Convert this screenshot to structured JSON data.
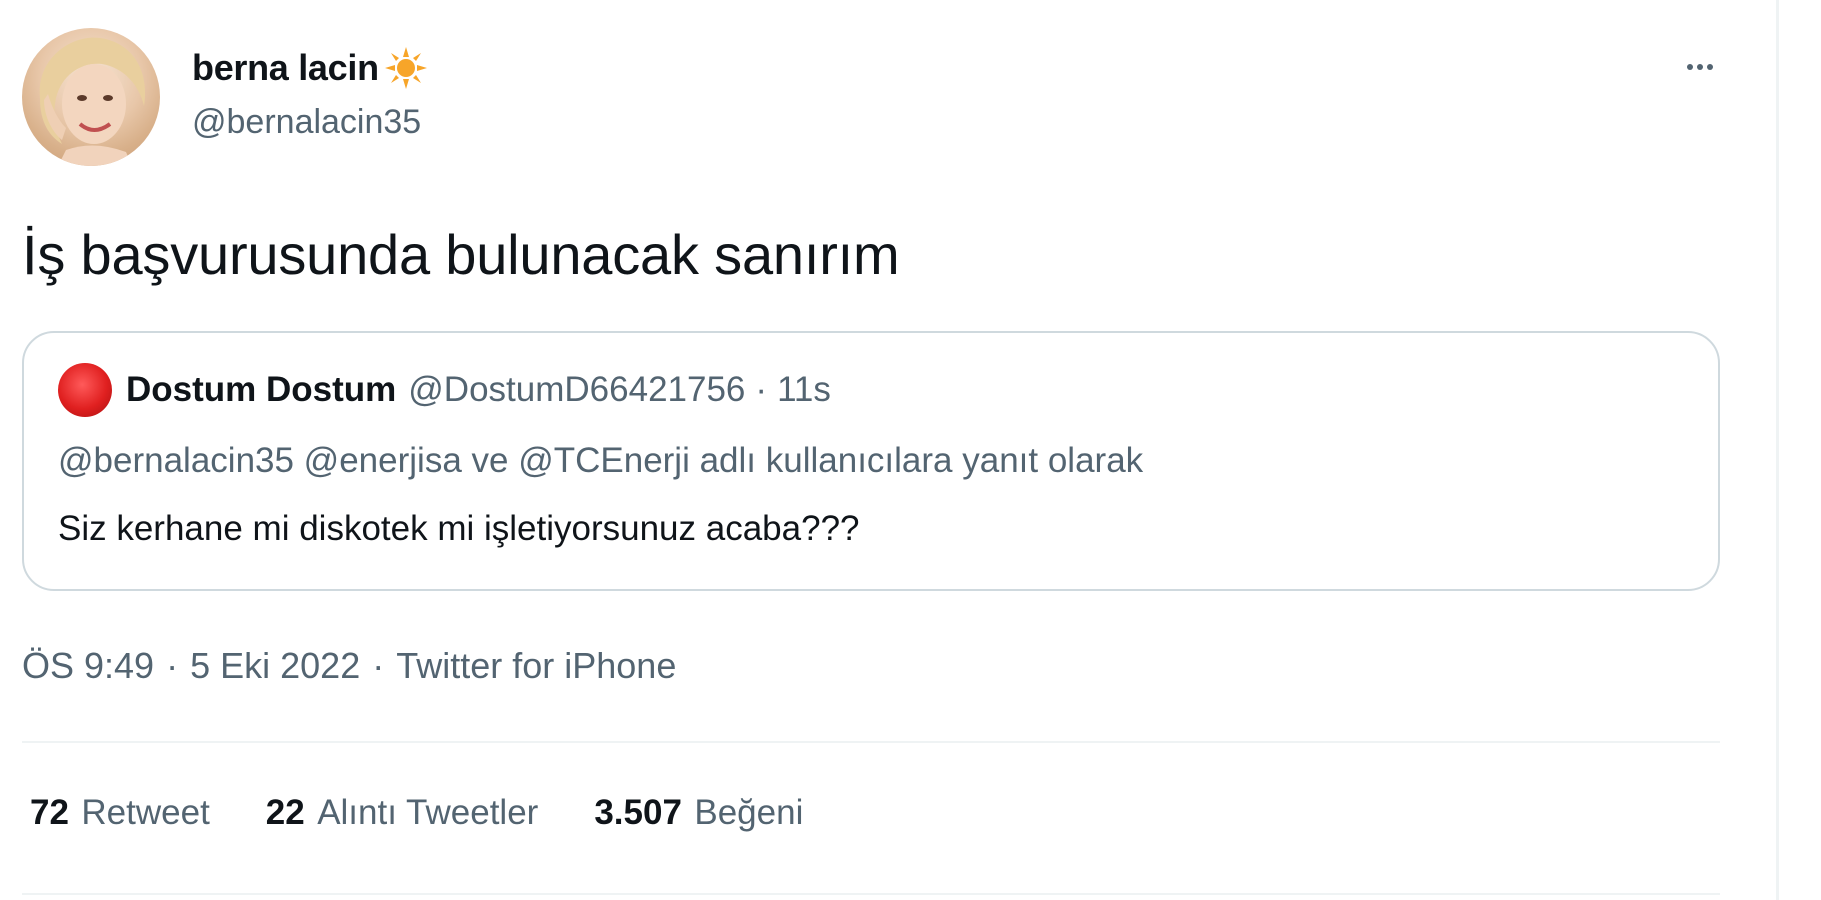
{
  "author": {
    "display_name": "berna lacin",
    "handle": "@bernalacin35",
    "badge_icon": "sun-emoji-icon"
  },
  "tweet": {
    "text": "İş başvurusunda bulunacak sanırım"
  },
  "quoted_tweet": {
    "display_name": "Dostum Dostum",
    "handle": "@DostumD66421756",
    "separator": "·",
    "time": "11s",
    "reply_context": "@bernalacin35 @enerjisa ve @TCEnerji adlı kullanıcılara yanıt olarak",
    "text": "Siz kerhane mi diskotek mi işletiyorsunuz acaba???"
  },
  "meta": {
    "time": "ÖS 9:49",
    "separator": "·",
    "date": "5 Eki 2022",
    "source": "Twitter for iPhone"
  },
  "stats": {
    "retweets": {
      "count": "72",
      "label": "Retweet"
    },
    "quotes": {
      "count": "22",
      "label": "Alıntı Tweetler"
    },
    "likes": {
      "count": "3.507",
      "label": "Beğeni"
    }
  },
  "colors": {
    "text_primary": "#0f1419",
    "text_secondary": "#536471",
    "border": "#cfd9de",
    "divider": "#eff3f4",
    "badge": "#f7a529"
  }
}
